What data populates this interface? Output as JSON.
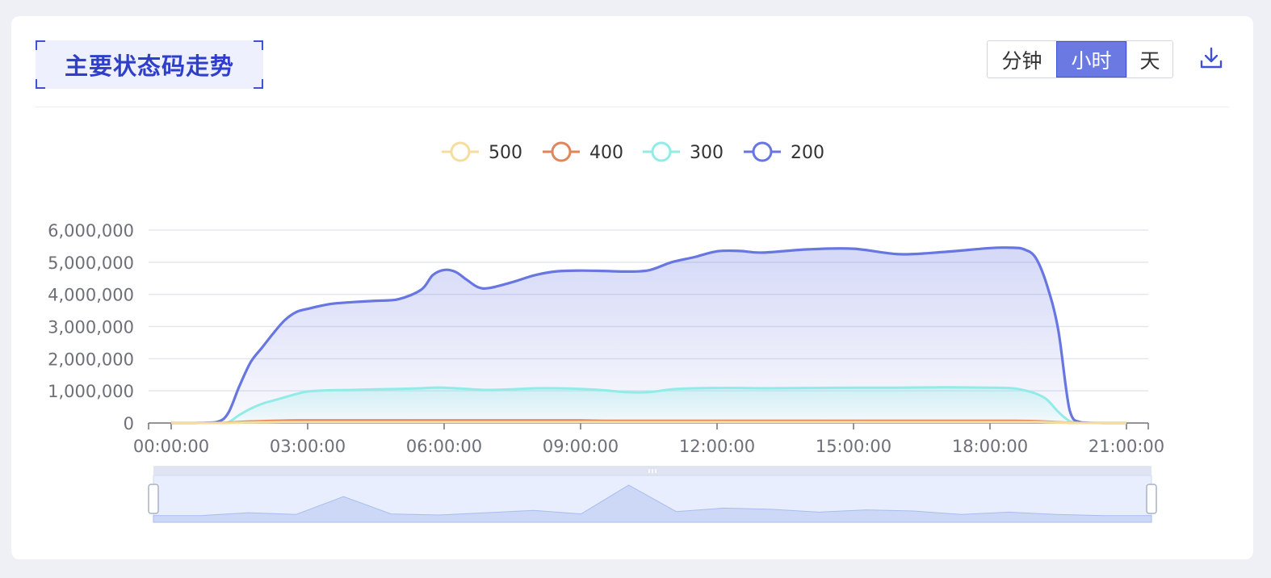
{
  "panel": {
    "title": "主要状态码走势",
    "granularity": {
      "options": [
        "分钟",
        "小时",
        "天"
      ],
      "selected": "小时"
    },
    "download_icon": "download-icon"
  },
  "colors": {
    "accent": "#3f51d6",
    "series_500": "#f5dd9e",
    "series_400": "#e0855a",
    "series_300": "#91ebe6",
    "series_200": "#6776e0"
  },
  "chart_data": {
    "type": "area",
    "title": "",
    "xlabel": "",
    "ylabel": "",
    "x_ticks": [
      "00:00:00",
      "03:00:00",
      "06:00:00",
      "09:00:00",
      "12:00:00",
      "15:00:00",
      "18:00:00",
      "21:00:00"
    ],
    "y_ticks": [
      "0",
      "1,000,000",
      "2,000,000",
      "3,000,000",
      "4,000,000",
      "5,000,000",
      "6,000,000"
    ],
    "ylim": [
      0,
      6000000
    ],
    "x_hours": [
      0,
      0.5,
      1,
      1.25,
      1.5,
      1.75,
      2,
      2.25,
      2.5,
      2.75,
      3,
      3.5,
      4,
      4.5,
      5,
      5.5,
      5.75,
      6,
      6.25,
      6.5,
      6.75,
      7,
      7.5,
      8,
      8.5,
      9,
      9.5,
      10,
      10.5,
      11,
      11.5,
      12,
      12.5,
      13,
      14,
      15,
      16,
      17,
      18,
      18.5,
      18.75,
      19,
      19.25,
      19.5,
      19.75,
      20,
      20.5,
      21
    ],
    "series": [
      {
        "name": "500",
        "color": "#f5dd9e",
        "values": [
          0,
          0,
          0,
          0,
          10000,
          20000,
          25000,
          28000,
          30000,
          30000,
          30000,
          30000,
          30000,
          30000,
          30000,
          30000,
          30000,
          30000,
          30000,
          30000,
          30000,
          30000,
          30000,
          30000,
          30000,
          30000,
          30000,
          30000,
          30000,
          30000,
          30000,
          30000,
          30000,
          30000,
          30000,
          30000,
          30000,
          30000,
          30000,
          30000,
          30000,
          30000,
          25000,
          15000,
          5000,
          0,
          0,
          0
        ]
      },
      {
        "name": "400",
        "color": "#e0855a",
        "values": [
          0,
          0,
          0,
          10000,
          30000,
          50000,
          60000,
          70000,
          75000,
          80000,
          80000,
          80000,
          80000,
          80000,
          80000,
          80000,
          80000,
          80000,
          80000,
          80000,
          80000,
          80000,
          80000,
          80000,
          80000,
          80000,
          70000,
          70000,
          70000,
          70000,
          70000,
          70000,
          70000,
          70000,
          70000,
          70000,
          70000,
          70000,
          70000,
          70000,
          65000,
          60000,
          45000,
          25000,
          8000,
          0,
          0,
          0
        ]
      },
      {
        "name": "300",
        "color": "#91ebe6",
        "values": [
          0,
          0,
          0,
          20000,
          250000,
          450000,
          600000,
          700000,
          800000,
          900000,
          980000,
          1020000,
          1030000,
          1050000,
          1060000,
          1080000,
          1100000,
          1100000,
          1080000,
          1060000,
          1040000,
          1030000,
          1050000,
          1080000,
          1080000,
          1060000,
          1020000,
          960000,
          960000,
          1050000,
          1080000,
          1090000,
          1090000,
          1080000,
          1090000,
          1100000,
          1100000,
          1110000,
          1100000,
          1080000,
          1020000,
          920000,
          730000,
          350000,
          60000,
          0,
          0,
          0
        ]
      },
      {
        "name": "200",
        "color": "#6776e0",
        "values": [
          0,
          0,
          30000,
          300000,
          1150000,
          1900000,
          2350000,
          2800000,
          3200000,
          3450000,
          3550000,
          3700000,
          3760000,
          3800000,
          3850000,
          4150000,
          4600000,
          4760000,
          4700000,
          4450000,
          4220000,
          4200000,
          4380000,
          4600000,
          4720000,
          4740000,
          4730000,
          4710000,
          4750000,
          5000000,
          5160000,
          5340000,
          5350000,
          5300000,
          5400000,
          5420000,
          5250000,
          5320000,
          5440000,
          5450000,
          5400000,
          5150000,
          4300000,
          2900000,
          400000,
          20000,
          0,
          0
        ]
      }
    ],
    "legend": {
      "items": [
        "500",
        "400",
        "300",
        "200"
      ],
      "position": "top-center"
    },
    "grid": true,
    "data_zoom": {
      "range": [
        0,
        100
      ],
      "preview": [
        0.6,
        0.6,
        1.1,
        0.8,
        3.9,
        0.9,
        0.7,
        1.1,
        1.5,
        0.9,
        5.9,
        1.3,
        1.9,
        1.7,
        1.2,
        1.6,
        1.4,
        0.8,
        1.2,
        0.8,
        0.6,
        0.6
      ]
    }
  }
}
